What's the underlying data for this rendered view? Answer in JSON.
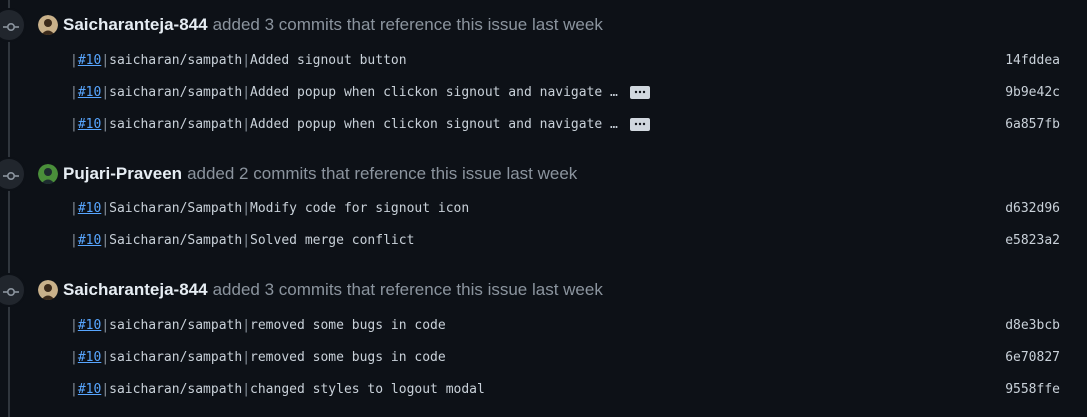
{
  "events": [
    {
      "author": "Saicharanteja-844",
      "action": "added 3 commits that reference this issue last week",
      "avatar_colors": [
        "#c9b18a",
        "#3b2a1a"
      ],
      "commits": [
        {
          "issue": "#10",
          "repo": "saicharan/sampath",
          "message": "Added signout button",
          "sha": "14fddea",
          "truncated": false
        },
        {
          "issue": "#10",
          "repo": "saicharan/sampath",
          "message": "Added popup when clickon signout and navigate …",
          "sha": "9b9e42c",
          "truncated": true
        },
        {
          "issue": "#10",
          "repo": "saicharan/sampath",
          "message": "Added popup when clickon signout and navigate …",
          "sha": "6a857fb",
          "truncated": true
        }
      ]
    },
    {
      "author": "Pujari-Praveen",
      "action": "added 2 commits that reference this issue last week",
      "avatar_colors": [
        "#4a8f3a",
        "#1d2b2f"
      ],
      "commits": [
        {
          "issue": "#10",
          "repo": "Saicharan/Sampath",
          "message": "Modify code for signout icon",
          "sha": "d632d96",
          "truncated": false
        },
        {
          "issue": "#10",
          "repo": "Saicharan/Sampath",
          "message": "Solved merge conflict",
          "sha": "e5823a2",
          "truncated": false
        }
      ]
    },
    {
      "author": "Saicharanteja-844",
      "action": "added 3 commits that reference this issue last week",
      "avatar_colors": [
        "#c9b18a",
        "#3b2a1a"
      ],
      "commits": [
        {
          "issue": "#10",
          "repo": "saicharan/sampath",
          "message": "removed some bugs in code",
          "sha": "d8e3bcb",
          "truncated": false
        },
        {
          "issue": "#10",
          "repo": "saicharan/sampath",
          "message": "removed some bugs in code",
          "sha": "6e70827",
          "truncated": false
        },
        {
          "issue": "#10",
          "repo": "saicharan/sampath",
          "message": "changed styles to logout modal",
          "sha": "9558ffe",
          "truncated": false
        }
      ]
    }
  ],
  "ellipsis_label": "…",
  "colors": {
    "background": "#0d1117",
    "link": "#58a6ff",
    "muted": "#8b949e",
    "text": "#c9d1d9",
    "timeline": "#30363d"
  }
}
